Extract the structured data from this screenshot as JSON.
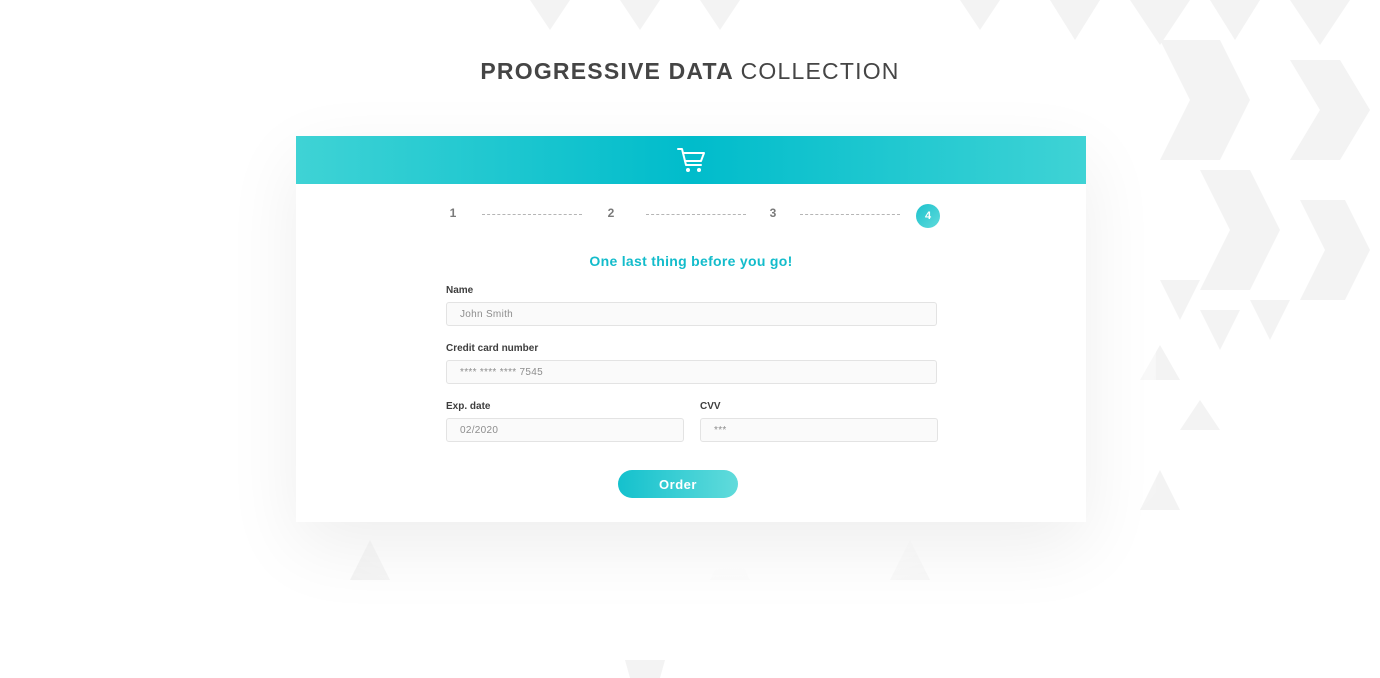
{
  "page": {
    "title_bold": "PROGRESSIVE DATA",
    "title_light": "COLLECTION"
  },
  "card": {
    "header_icon": "shopping-cart-icon",
    "stepper": {
      "steps": [
        "1",
        "2",
        "3",
        "4"
      ],
      "active_step": "4"
    },
    "heading": "One last thing before you go!",
    "form": {
      "name": {
        "label": "Name",
        "value": "John Smith"
      },
      "card_number": {
        "label": "Credit card number",
        "value": "**** **** **** 7545"
      },
      "exp_date": {
        "label": "Exp. date",
        "value": "02/2020"
      },
      "cvv": {
        "label": "CVV",
        "value": "***"
      }
    },
    "order_button": "Order"
  },
  "colors": {
    "accent": "#13bccb",
    "header_gradient": [
      "#3fd3d5",
      "#00bccb"
    ],
    "title_text": "#454545",
    "label_text": "#3e3e3e"
  }
}
